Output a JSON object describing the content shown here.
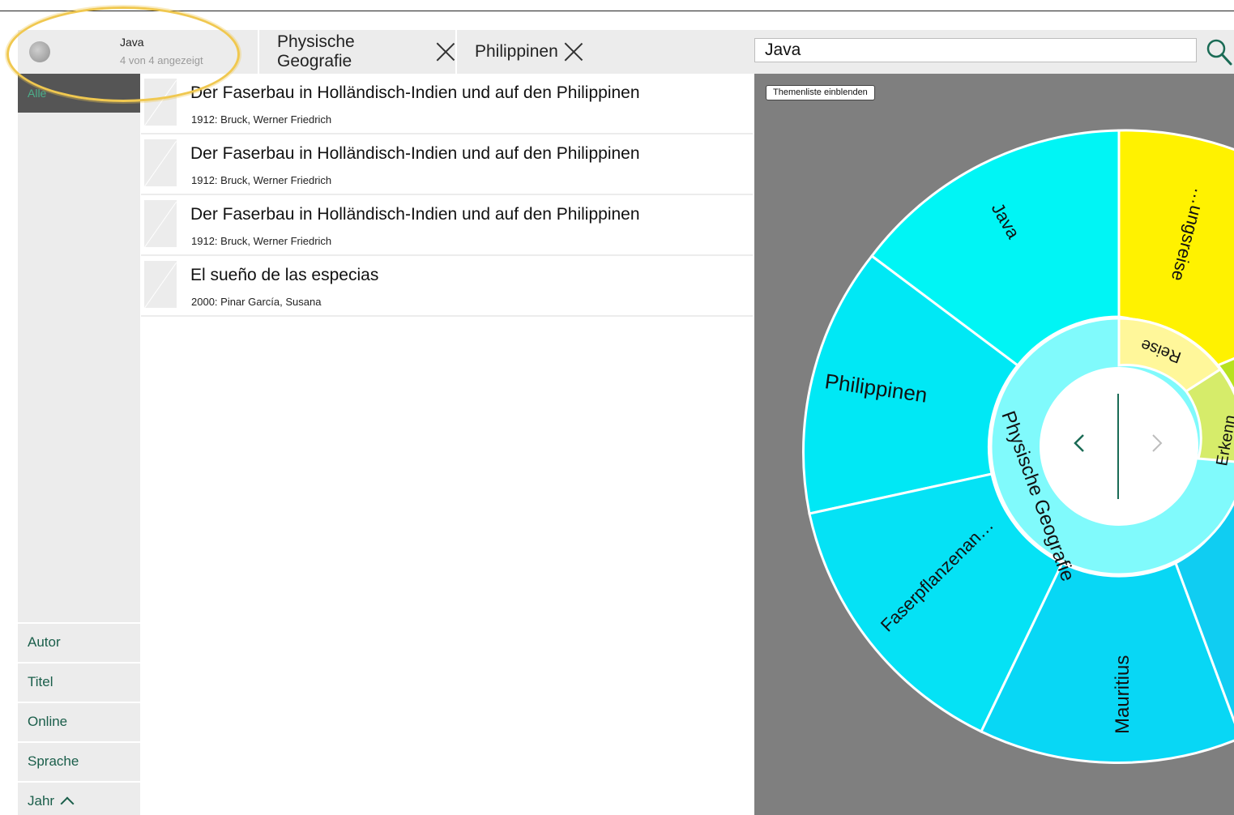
{
  "header": {
    "query_title": "Java",
    "query_count": "4 von 4 angezeigt",
    "facets": [
      {
        "label": "Physische Geografie"
      },
      {
        "label": "Philippinen"
      }
    ],
    "search": {
      "value": "Java"
    }
  },
  "sidebar": {
    "all_label": "Alle",
    "items": [
      {
        "label": "Autor"
      },
      {
        "label": "Titel"
      },
      {
        "label": "Online"
      },
      {
        "label": "Sprache"
      },
      {
        "label": "Jahr"
      }
    ]
  },
  "results": [
    {
      "title": "Der Faserbau in Holländisch-Indien und auf den Philippinen",
      "meta": "1912: Bruck, Werner Friedrich"
    },
    {
      "title": "Der Faserbau in Holländisch-Indien und auf den Philippinen",
      "meta": "1912: Bruck, Werner Friedrich"
    },
    {
      "title": "Der Faserbau in Holländisch-Indien und auf den Philippinen",
      "meta": "1912: Bruck, Werner Friedrich"
    },
    {
      "title": "El sueño de las especias",
      "meta": "2000: Pinar García, Susana"
    }
  ],
  "viz": {
    "toggle_label": "Themenliste einblenden",
    "inner_label": "Physische Geografie",
    "inner_right_labels": [
      "Reise",
      "Erkenn…"
    ],
    "outer_labels": [
      "Java",
      "Philippinen",
      "Faserpflanzenan…",
      "Mauritius",
      "…ungsreise"
    ],
    "colors": {
      "background": "#7f7f7f",
      "cyan_1": "#00f5f5",
      "cyan_2": "#00e8f5",
      "cyan_3": "#05e2f5",
      "cyan_4": "#08d7f5",
      "inner_ring": "#80fafc",
      "yellow": "#fff200",
      "light_yellow": "#fff79a",
      "green": "#d6ec6a",
      "accent": "#1a6b55"
    },
    "nav": {
      "prev": "‹",
      "next": "›"
    }
  }
}
